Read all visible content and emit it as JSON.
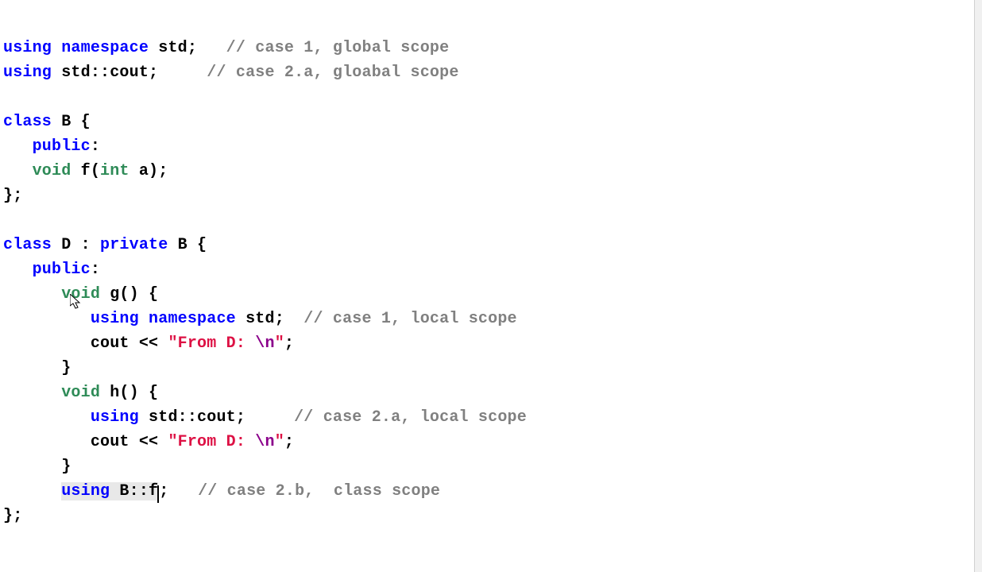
{
  "code": {
    "line1": {
      "kw1": "using",
      "kw2": "namespace",
      "ident": "std",
      "semi": ";   ",
      "cmt": "// case 1, global scope"
    },
    "line2": {
      "kw1": "using",
      "ident": "std::cout",
      "semi": ";     ",
      "cmt": "// case 2.a, gloabal scope"
    },
    "line4": {
      "kw": "class",
      "name": " B {"
    },
    "line5": {
      "kw": "public",
      "colon": ":"
    },
    "line6": {
      "type": "void",
      "rest": " f(",
      "type2": "int",
      "rest2": " a);"
    },
    "line7": {
      "txt": "};"
    },
    "line9": {
      "kw1": "class",
      "name": " D : ",
      "kw2": "private",
      "rest": " B {"
    },
    "line10": {
      "kw": "public",
      "colon": ":"
    },
    "line11": {
      "type": "void",
      "rest": " g() {"
    },
    "line12": {
      "kw1": "using",
      "kw2": "namespace",
      "ident": "std",
      "semi": ";  ",
      "cmt": "// case 1, local scope"
    },
    "line13": {
      "ident": "cout << ",
      "str_open": "\"",
      "str": "From D: ",
      "esc": "\\n",
      "str_close": "\"",
      "semi": ";"
    },
    "line14": {
      "txt": "}"
    },
    "line15": {
      "type": "void",
      "rest": " h() {"
    },
    "line16": {
      "kw1": "using",
      "ident": "std::cout",
      "semi": ";     ",
      "cmt": "// case 2.a, local scope"
    },
    "line17": {
      "ident": "cout << ",
      "str_open": "\"",
      "str": "From D: ",
      "esc": "\\n",
      "str_close": "\"",
      "semi": ";"
    },
    "line18": {
      "txt": "}"
    },
    "line19": {
      "kw1": "using",
      "ident": " B::f",
      "semi": ";   ",
      "cmt": "// case 2.b,  class scope"
    },
    "line20": {
      "txt": "};"
    }
  }
}
